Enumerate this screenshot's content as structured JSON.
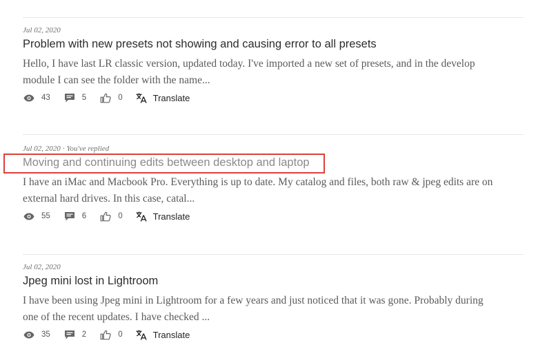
{
  "posts": [
    {
      "date": "Jul 02, 2020",
      "reply_note": "",
      "title": "Problem with new presets not showing and causing error to all presets",
      "excerpt_lines": [
        "Hello, I have last LR classic version, updated today. I've imported a new set of presets, and in the develop",
        "module I can see the folder with the name..."
      ],
      "views": "43",
      "replies": "5",
      "likes": "0",
      "translate_label": "Translate"
    },
    {
      "date": "Jul 02, 2020",
      "reply_note": "You've replied",
      "title": "Moving and continuing edits between desktop and laptop",
      "excerpt_lines": [
        "I have an iMac and Macbook Pro. Everything is up to date. My catalog and files, both raw & jpeg edits are on",
        "external hard drives. In this case, catal..."
      ],
      "views": "55",
      "replies": "6",
      "likes": "0",
      "translate_label": "Translate"
    },
    {
      "date": "Jul 02, 2020",
      "reply_note": "",
      "title": "Jpeg mini lost in Lightroom",
      "excerpt_lines": [
        "I have been using Jpeg mini in Lightroom for a few years and just noticed that it was gone. Probably during",
        "one of the recent updates. I have checked ..."
      ],
      "views": "35",
      "replies": "2",
      "likes": "0",
      "translate_label": "Translate"
    }
  ]
}
